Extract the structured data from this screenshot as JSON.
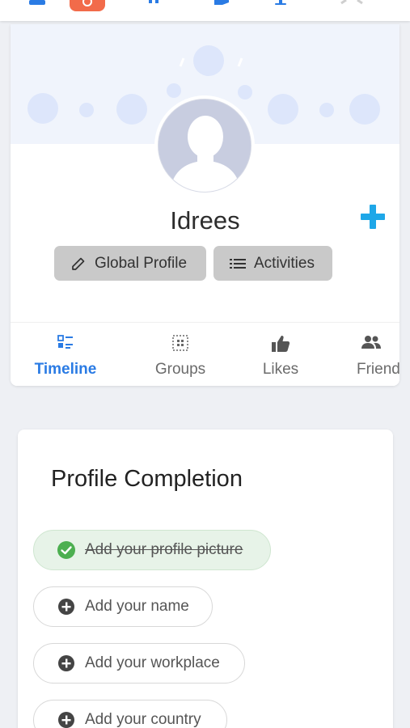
{
  "topbar": {
    "icons": [
      "menu-icon",
      "app-logo-icon",
      "apps-icon",
      "chat-icon",
      "notifications-icon",
      "people-icon"
    ],
    "brand_color": "#f26b4a"
  },
  "profile": {
    "name": "Idrees",
    "global_profile_label": "Global Profile",
    "activities_label": "Activities",
    "accent_color": "#1ea7e8"
  },
  "tabs": [
    {
      "label": "Timeline",
      "icon": "timeline-icon",
      "active": true
    },
    {
      "label": "Groups",
      "icon": "groups-icon",
      "active": false
    },
    {
      "label": "Likes",
      "icon": "thumb-up-icon",
      "active": false
    },
    {
      "label": "Friend",
      "icon": "friends-icon",
      "active": false
    }
  ],
  "completion": {
    "title": "Profile Completion",
    "items": [
      {
        "label": "Add your profile picture",
        "done": true
      },
      {
        "label": "Add your name",
        "done": false
      },
      {
        "label": "Add your workplace",
        "done": false
      },
      {
        "label": "Add your country",
        "done": false
      }
    ],
    "done_color": "#4caf50"
  }
}
